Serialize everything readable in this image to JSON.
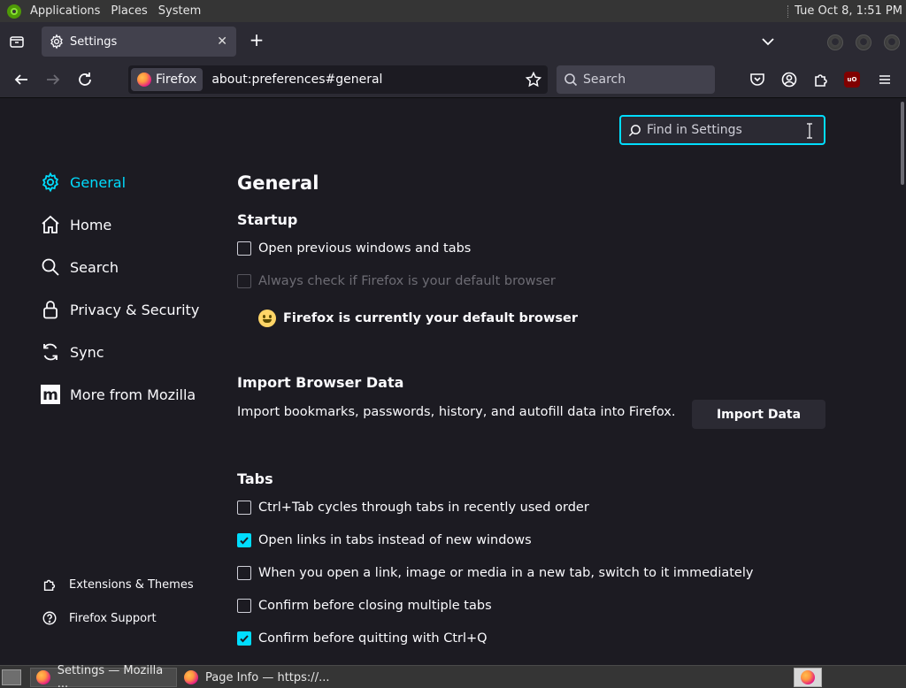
{
  "topbar": {
    "menus": [
      "Applications",
      "Places",
      "System"
    ],
    "clock": "Tue Oct  8,  1:51 PM"
  },
  "tab": {
    "title": "Settings"
  },
  "toolbar": {
    "identity_label": "Firefox",
    "url": "about:preferences#general",
    "search_placeholder": "Search"
  },
  "find": {
    "placeholder": "Find in Settings"
  },
  "sidebar": {
    "items": [
      "General",
      "Home",
      "Search",
      "Privacy & Security",
      "Sync",
      "More from Mozilla"
    ],
    "footer": [
      "Extensions & Themes",
      "Firefox Support"
    ]
  },
  "main": {
    "heading": "General",
    "startup": {
      "title": "Startup",
      "open_previous": "Open previous windows and tabs",
      "always_check": "Always check if Firefox is your default browser",
      "default_note": "Firefox is currently your default browser"
    },
    "import": {
      "title": "Import Browser Data",
      "description": "Import bookmarks, passwords, history, and autofill data into Firefox.",
      "button": "Import Data"
    },
    "tabs": {
      "title": "Tabs",
      "options": [
        {
          "label": "Ctrl+Tab cycles through tabs in recently used order",
          "checked": false
        },
        {
          "label": "Open links in tabs instead of new windows",
          "checked": true
        },
        {
          "label": "When you open a link, image or media in a new tab, switch to it immediately",
          "checked": false
        },
        {
          "label": "Confirm before closing multiple tabs",
          "checked": false
        },
        {
          "label": "Confirm before quitting with Ctrl+Q",
          "checked": true
        }
      ]
    }
  },
  "taskbar": {
    "tasks": [
      "Settings — Mozilla ...",
      "Page Info — https://..."
    ]
  },
  "colors": {
    "accent": "#00ddff",
    "background": "#1c1b22",
    "toolbar": "#2b2a33"
  }
}
